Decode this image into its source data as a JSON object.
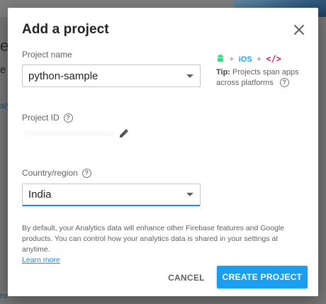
{
  "background": {
    "fragment_1": "e",
    "fragment_2": "e",
    "link_fragment": "alytic",
    "bottom_fragment": "ro"
  },
  "dialog": {
    "title": "Add a project",
    "close_icon": "close-icon",
    "project_name": {
      "label": "Project name",
      "value": "python-sample"
    },
    "tip": {
      "plus": "+",
      "ios": "iOS",
      "web": "</>",
      "bold": "Tip:",
      "text": " Projects span apps across platforms"
    },
    "project_id": {
      "label": "Project ID",
      "help": "?"
    },
    "country": {
      "label": "Country/region",
      "help": "?",
      "value": "India"
    },
    "description": "By default, your Analytics data will enhance other Firebase features and Google products. You can control how your analytics data is shared in your settings at anytime.",
    "learn_more": "Learn more",
    "cancel_label": "CANCEL",
    "create_label": "CREATE PROJECT",
    "accent_color": "#1a9ff0"
  }
}
